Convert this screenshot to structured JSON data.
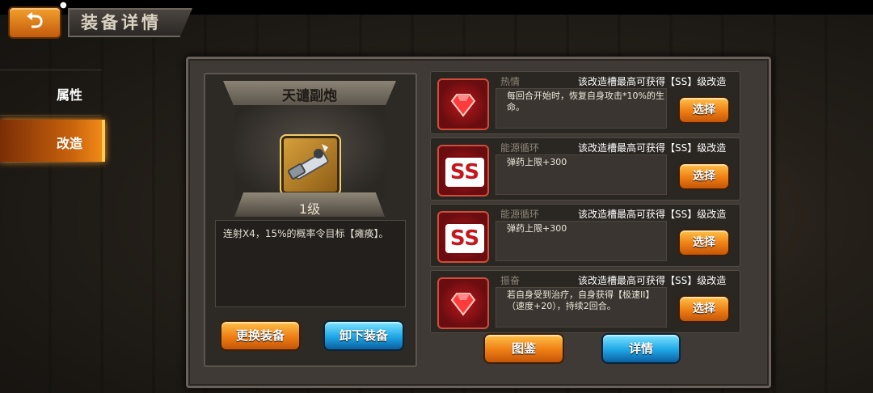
{
  "status_bar": {
    "icon": "notification-icon"
  },
  "header": {
    "title": "装备详情",
    "back_icon": "back-arrow-icon"
  },
  "sidebar": {
    "items": [
      {
        "label": "属性",
        "active": false
      },
      {
        "label": "改造",
        "active": true
      }
    ]
  },
  "equipment": {
    "name": "天谴副炮",
    "level": "1级",
    "description": "连射X4，15%的概率令目标【瘫痪】。",
    "buttons": {
      "replace": "更换装备",
      "unequip": "卸下装备"
    }
  },
  "slots": [
    {
      "icon": "red-gem-icon",
      "name": "热情",
      "hint": "该改造槽最高可获得【SS】级改造",
      "desc": "每回合开始时，恢复自身攻击*10%的生命。",
      "button": "选择"
    },
    {
      "icon": "ss-rank-icon",
      "icon_text": "SS",
      "name": "能源循环",
      "hint": "该改造槽最高可获得【SS】级改造",
      "desc": "弹药上限+300",
      "button": "选择"
    },
    {
      "icon": "ss-rank-icon",
      "icon_text": "SS",
      "name": "能源循环",
      "hint": "该改造槽最高可获得【SS】级改造",
      "desc": "弹药上限+300",
      "button": "选择"
    },
    {
      "icon": "red-gem-icon",
      "name": "振奋",
      "hint": "该改造槽最高可获得【SS】级改造",
      "desc": "若自身受到治疗，自身获得【极速II】（速度+20），持续2回合。",
      "button": "选择"
    }
  ],
  "bottom_buttons": {
    "catalog": "图鉴",
    "details": "详情"
  },
  "colors": {
    "accent_orange": "#ef7e14",
    "accent_blue": "#1fa6e6",
    "ss_red": "#c4161c"
  }
}
